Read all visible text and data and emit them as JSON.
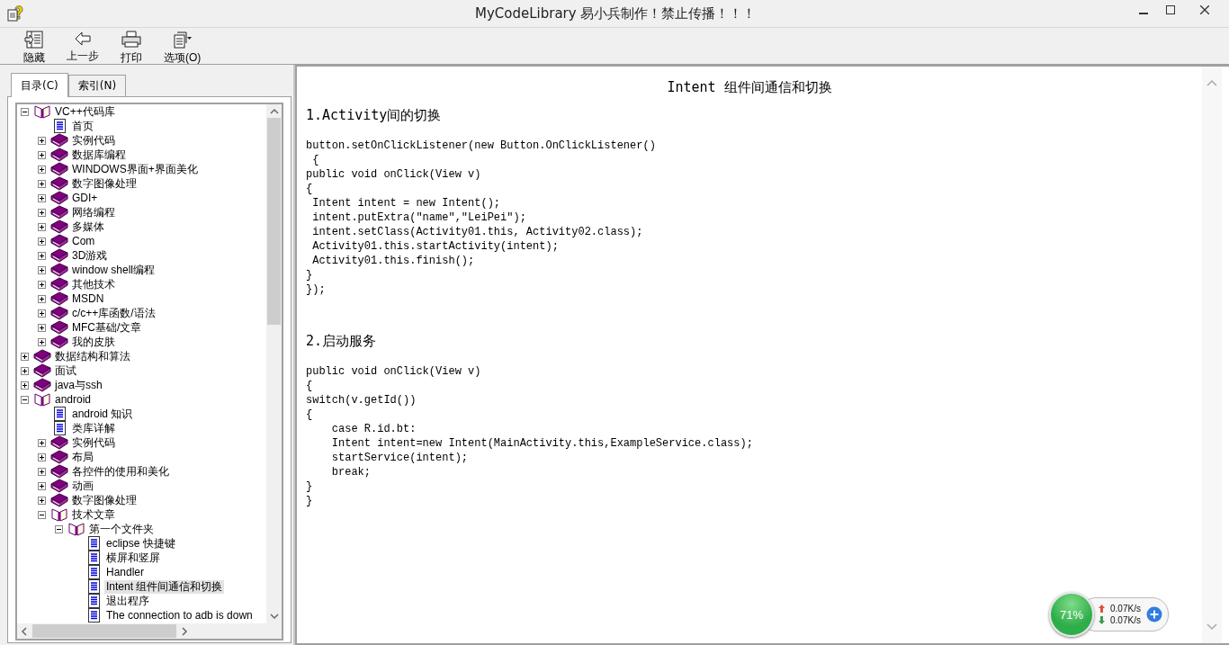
{
  "window": {
    "title": "MyCodeLibrary 易小兵制作！禁止传播！！！"
  },
  "toolbar": [
    {
      "label": "隐藏",
      "kind": "hide"
    },
    {
      "label": "上一步",
      "kind": "back"
    },
    {
      "label": "打印",
      "kind": "print"
    },
    {
      "label": "选项(O)",
      "kind": "options"
    }
  ],
  "tabs": [
    {
      "label": "目录(C)",
      "selected": true
    },
    {
      "label": "索引(N)",
      "selected": false
    }
  ],
  "tree": {
    "items": [
      {
        "label": "VC++代码库",
        "kind": "book",
        "expanded": true,
        "selected": false,
        "children": [
          {
            "label": "首页",
            "kind": "page",
            "selected": false
          },
          {
            "label": "实例代码",
            "kind": "book",
            "expanded": false,
            "selected": false
          },
          {
            "label": "数据库编程",
            "kind": "book",
            "expanded": false,
            "selected": false
          },
          {
            "label": "WINDOWS界面+界面美化",
            "kind": "book",
            "expanded": false,
            "selected": false
          },
          {
            "label": "数字图像处理",
            "kind": "book",
            "expanded": false,
            "selected": false
          },
          {
            "label": "GDI+",
            "kind": "book",
            "expanded": false,
            "selected": false
          },
          {
            "label": "网络编程",
            "kind": "book",
            "expanded": false,
            "selected": false
          },
          {
            "label": "多媒体",
            "kind": "book",
            "expanded": false,
            "selected": false
          },
          {
            "label": "Com",
            "kind": "book",
            "expanded": false,
            "selected": false
          },
          {
            "label": "3D游戏",
            "kind": "book",
            "expanded": false,
            "selected": false
          },
          {
            "label": "window shell编程",
            "kind": "book",
            "expanded": false,
            "selected": false
          },
          {
            "label": "其他技术",
            "kind": "book",
            "expanded": false,
            "selected": false
          },
          {
            "label": "MSDN",
            "kind": "book",
            "expanded": false,
            "selected": false
          },
          {
            "label": "c/c++库函数/语法",
            "kind": "book",
            "expanded": false,
            "selected": false
          },
          {
            "label": "MFC基础/文章",
            "kind": "book",
            "expanded": false,
            "selected": false
          },
          {
            "label": "我的皮肤",
            "kind": "book",
            "expanded": false,
            "selected": false
          }
        ]
      },
      {
        "label": "数据结构和算法",
        "kind": "book",
        "expanded": false,
        "selected": false
      },
      {
        "label": "面试",
        "kind": "book",
        "expanded": false,
        "selected": false
      },
      {
        "label": "java与ssh",
        "kind": "book",
        "expanded": false,
        "selected": false
      },
      {
        "label": "android",
        "kind": "book",
        "expanded": true,
        "selected": false,
        "children": [
          {
            "label": "android 知识",
            "kind": "page",
            "selected": false
          },
          {
            "label": "类库详解",
            "kind": "page",
            "selected": false
          },
          {
            "label": "实例代码",
            "kind": "book",
            "expanded": false,
            "selected": false
          },
          {
            "label": "布局",
            "kind": "book",
            "expanded": false,
            "selected": false
          },
          {
            "label": "各控件的使用和美化",
            "kind": "book",
            "expanded": false,
            "selected": false
          },
          {
            "label": "动画",
            "kind": "book",
            "expanded": false,
            "selected": false
          },
          {
            "label": "数字图像处理",
            "kind": "book",
            "expanded": false,
            "selected": false
          },
          {
            "label": "技术文章",
            "kind": "book",
            "expanded": true,
            "selected": false,
            "children": [
              {
                "label": "第一个文件夹",
                "kind": "book",
                "expanded": true,
                "selected": false,
                "children": [
                  {
                    "label": "eclipse 快捷键",
                    "kind": "page",
                    "selected": false
                  },
                  {
                    "label": "横屏和竖屏",
                    "kind": "page",
                    "selected": false
                  },
                  {
                    "label": "Handler",
                    "kind": "page",
                    "selected": false
                  },
                  {
                    "label": "Intent 组件间通信和切换",
                    "kind": "page",
                    "selected": true
                  },
                  {
                    "label": "退出程序",
                    "kind": "page",
                    "selected": false
                  },
                  {
                    "label": "The connection to adb is down",
                    "kind": "page",
                    "selected": false
                  }
                ]
              }
            ]
          }
        ]
      }
    ]
  },
  "article": {
    "title": "Intent 组件间通信和切换",
    "sections": [
      {
        "heading": "1.Activity间的切换",
        "code": [
          "button.setOnClickListener(new Button.OnClickListener()",
          " {",
          "public void onClick(View v)",
          "{",
          " Intent intent = new Intent();",
          " intent.putExtra(\"name\",\"LeiPei\");",
          " intent.setClass(Activity01.this, Activity02.class);",
          " Activity01.this.startActivity(intent);",
          " Activity01.this.finish();",
          "}",
          "});"
        ]
      },
      {
        "heading": "2.启动服务",
        "code": [
          "public void onClick(View v)",
          "{",
          "switch(v.getId())",
          "{",
          "    case R.id.bt:",
          "    Intent intent=new Intent(MainActivity.this,ExampleService.class);",
          "    startService(intent);",
          "    break;",
          "}",
          "}"
        ]
      }
    ]
  },
  "monitor": {
    "usage": "71%",
    "upload": "0.07K/s",
    "download": "0.07K/s"
  }
}
